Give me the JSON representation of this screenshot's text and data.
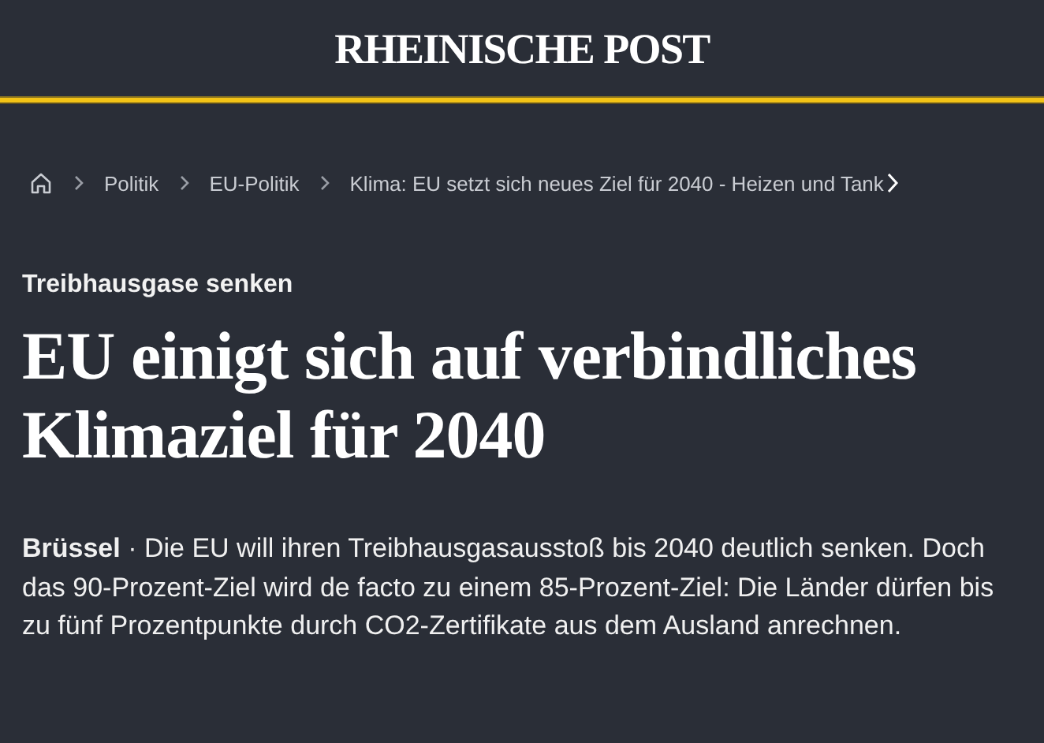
{
  "header": {
    "logo": "RHEINISCHE POST"
  },
  "breadcrumb": {
    "items": [
      {
        "label": "Politik"
      },
      {
        "label": "EU-Politik"
      },
      {
        "label": "Klima: EU setzt sich neues Ziel für 2040 - Heizen und Tank"
      }
    ]
  },
  "article": {
    "kicker": "Treibhausgase senken",
    "headline": "EU einigt sich auf verbindliches Klimaziel für 2040",
    "lead": "**Brüssel** · Die EU will ihren Treibhausgasausstoß bis 2040 deutlich senken. Doch das 90-Prozent-Ziel wird de facto zu einem 85-Prozent-Ziel: Die Länder dürfen bis zu fünf Prozentpunkte durch CO2-Zertifikate aus dem Ausland anrechnen."
  }
}
